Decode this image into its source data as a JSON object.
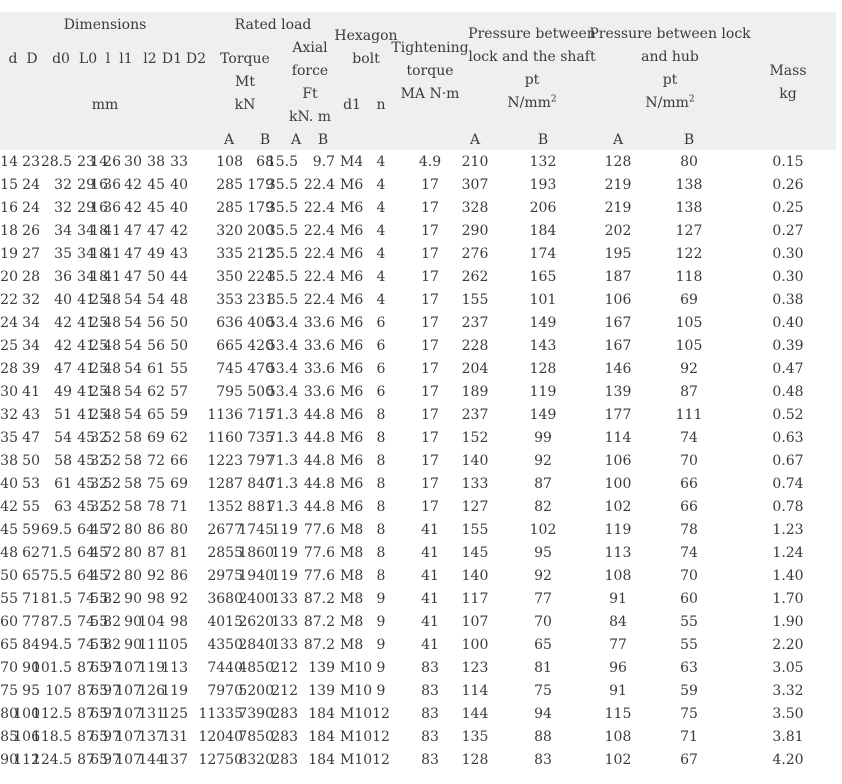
{
  "header": {
    "dimensions": "Dimensions",
    "rated_load": "Rated load",
    "hexagon": "Hexagon",
    "bolt": "bolt",
    "tightening": "Tightening",
    "torque_word": "torque",
    "torque_unit": "MA N·m",
    "pressure_shaft": "Pressure between",
    "pressure_shaft_2": "lock and the shaft",
    "pressure_hub": "Pressure between lock",
    "pressure_hub_2": "and hub",
    "pt": "pt",
    "pressure_unit": "N/mm",
    "pressure_unit_exp": "2",
    "torque": "Torque",
    "mt": "Mt",
    "kn": "kN",
    "axial": "Axial",
    "force": "force",
    "ft": "Ft",
    "kn_m": "kN.  m",
    "mass": "Mass",
    "kg": "kg",
    "mm": "mm",
    "d": "d",
    "D": "D",
    "d0": "d0",
    "L0": "L0",
    "l": "l",
    "l1": "l1",
    "l2": "l2",
    "D1": "D1",
    "D2": "D2",
    "d1": "d1",
    "n": "n",
    "A": "A",
    "B": "B"
  },
  "rows": [
    [
      "14",
      "23",
      "28.5",
      "23",
      "14",
      "26",
      "30",
      "38",
      "33",
      "108",
      "68",
      "15.5",
      "9.7",
      "M4",
      "4",
      "4.9",
      "210",
      "132",
      "128",
      "80",
      "0.15"
    ],
    [
      "15",
      "24",
      "32",
      "29",
      "16",
      "36",
      "42",
      "45",
      "40",
      "285",
      "179",
      "35.5",
      "22.4",
      "M6",
      "4",
      "17",
      "307",
      "193",
      "219",
      "138",
      "0.26"
    ],
    [
      "16",
      "24",
      "32",
      "29",
      "16",
      "36",
      "42",
      "45",
      "40",
      "285",
      "179",
      "35.5",
      "22.4",
      "M6",
      "4",
      "17",
      "328",
      "206",
      "219",
      "138",
      "0.25"
    ],
    [
      "18",
      "26",
      "34",
      "34",
      "18",
      "41",
      "47",
      "47",
      "42",
      "320",
      "200",
      "35.5",
      "22.4",
      "M6",
      "4",
      "17",
      "290",
      "184",
      "202",
      "127",
      "0.27"
    ],
    [
      "19",
      "27",
      "35",
      "34",
      "18",
      "41",
      "47",
      "49",
      "43",
      "335",
      "212",
      "35.5",
      "22.4",
      "M6",
      "4",
      "17",
      "276",
      "174",
      "195",
      "122",
      "0.30"
    ],
    [
      "20",
      "28",
      "36",
      "34",
      "18",
      "41",
      "47",
      "50",
      "44",
      "350",
      "224",
      "35.5",
      "22.4",
      "M6",
      "4",
      "17",
      "262",
      "165",
      "187",
      "118",
      "0.30"
    ],
    [
      "22",
      "32",
      "40",
      "41",
      "25",
      "48",
      "54",
      "54",
      "48",
      "353",
      "231",
      "35.5",
      "22.4",
      "M6",
      "4",
      "17",
      "155",
      "101",
      "106",
      "69",
      "0.38"
    ],
    [
      "24",
      "34",
      "42",
      "41",
      "25",
      "48",
      "54",
      "56",
      "50",
      "636",
      "400",
      "53.4",
      "33.6",
      "M6",
      "6",
      "17",
      "237",
      "149",
      "167",
      "105",
      "0.40"
    ],
    [
      "25",
      "34",
      "42",
      "41",
      "25",
      "48",
      "54",
      "56",
      "50",
      "665",
      "420",
      "53.4",
      "33.6",
      "M6",
      "6",
      "17",
      "228",
      "143",
      "167",
      "105",
      "0.39"
    ],
    [
      "28",
      "39",
      "47",
      "41",
      "25",
      "48",
      "54",
      "61",
      "55",
      "745",
      "470",
      "53.4",
      "33.6",
      "M6",
      "6",
      "17",
      "204",
      "128",
      "146",
      "92",
      "0.47"
    ],
    [
      "30",
      "41",
      "49",
      "41",
      "25",
      "48",
      "54",
      "62",
      "57",
      "795",
      "500",
      "53.4",
      "33.6",
      "M6",
      "6",
      "17",
      "189",
      "119",
      "139",
      "87",
      "0.48"
    ],
    [
      "32",
      "43",
      "51",
      "41",
      "25",
      "48",
      "54",
      "65",
      "59",
      "1136",
      "715",
      "71.3",
      "44.8",
      "M6",
      "8",
      "17",
      "237",
      "149",
      "177",
      "111",
      "0.52"
    ],
    [
      "35",
      "47",
      "54",
      "45",
      "32",
      "52",
      "58",
      "69",
      "62",
      "1160",
      "735",
      "71.3",
      "44.8",
      "M6",
      "8",
      "17",
      "152",
      "99",
      "114",
      "74",
      "0.63"
    ],
    [
      "38",
      "50",
      "58",
      "45",
      "32",
      "52",
      "58",
      "72",
      "66",
      "1223",
      "797",
      "71.3",
      "44.8",
      "M6",
      "8",
      "17",
      "140",
      "92",
      "106",
      "70",
      "0.67"
    ],
    [
      "40",
      "53",
      "61",
      "45",
      "32",
      "52",
      "58",
      "75",
      "69",
      "1287",
      "840",
      "71.3",
      "44.8",
      "M6",
      "8",
      "17",
      "133",
      "87",
      "100",
      "66",
      "0.74"
    ],
    [
      "42",
      "55",
      "63",
      "45",
      "32",
      "52",
      "58",
      "78",
      "71",
      "1352",
      "881",
      "71.3",
      "44.8",
      "M6",
      "8",
      "17",
      "127",
      "82",
      "102",
      "66",
      "0.78"
    ],
    [
      "45",
      "59",
      "69.5",
      "64",
      "45",
      "72",
      "80",
      "86",
      "80",
      "2677",
      "1745",
      "119",
      "77.6",
      "M8",
      "8",
      "41",
      "155",
      "102",
      "119",
      "78",
      "1.23"
    ],
    [
      "48",
      "62",
      "71.5",
      "64",
      "45",
      "72",
      "80",
      "87",
      "81",
      "2855",
      "1860",
      "119",
      "77.6",
      "M8",
      "8",
      "41",
      "145",
      "95",
      "113",
      "74",
      "1.24"
    ],
    [
      "50",
      "65",
      "75.5",
      "64",
      "45",
      "72",
      "80",
      "92",
      "86",
      "2975",
      "1940",
      "119",
      "77.6",
      "M8",
      "8",
      "41",
      "140",
      "92",
      "108",
      "70",
      "1.40"
    ],
    [
      "55",
      "71",
      "81.5",
      "74",
      "55",
      "82",
      "90",
      "98",
      "92",
      "3680",
      "2400",
      "133",
      "87.2",
      "M8",
      "9",
      "41",
      "117",
      "77",
      "91",
      "60",
      "1.70"
    ],
    [
      "60",
      "77",
      "87.5",
      "74",
      "55",
      "82",
      "90",
      "104",
      "98",
      "4015",
      "2620",
      "133",
      "87.2",
      "M8",
      "9",
      "41",
      "107",
      "70",
      "84",
      "55",
      "1.90"
    ],
    [
      "65",
      "84",
      "94.5",
      "74",
      "55",
      "82",
      "90",
      "111",
      "105",
      "4350",
      "2840",
      "133",
      "87.2",
      "M8",
      "9",
      "41",
      "100",
      "65",
      "77",
      "55",
      "2.20"
    ],
    [
      "70",
      "90",
      "101.5",
      "87",
      "65",
      "97",
      "107",
      "119",
      "113",
      "7440",
      "4850",
      "212",
      "139",
      "M10",
      "9",
      "83",
      "123",
      "81",
      "96",
      "63",
      "3.05"
    ],
    [
      "75",
      "95",
      "107",
      "87",
      "65",
      "97",
      "107",
      "126",
      "119",
      "7970",
      "5200",
      "212",
      "139",
      "M10",
      "9",
      "83",
      "114",
      "75",
      "91",
      "59",
      "3.32"
    ],
    [
      "80",
      "100",
      "112.5",
      "87",
      "65",
      "97",
      "107",
      "131",
      "125",
      "11335",
      "7390",
      "283",
      "184",
      "M10",
      "12",
      "83",
      "144",
      "94",
      "115",
      "75",
      "3.50"
    ],
    [
      "85",
      "106",
      "118.5",
      "87",
      "65",
      "97",
      "107",
      "137",
      "131",
      "12040",
      "7850",
      "283",
      "184",
      "M10",
      "12",
      "83",
      "135",
      "88",
      "108",
      "71",
      "3.81"
    ],
    [
      "90",
      "112",
      "124.5",
      "87",
      "65",
      "97",
      "107",
      "144",
      "137",
      "12750",
      "8320",
      "283",
      "184",
      "M10",
      "12",
      "83",
      "128",
      "83",
      "102",
      "67",
      "4.20"
    ]
  ]
}
